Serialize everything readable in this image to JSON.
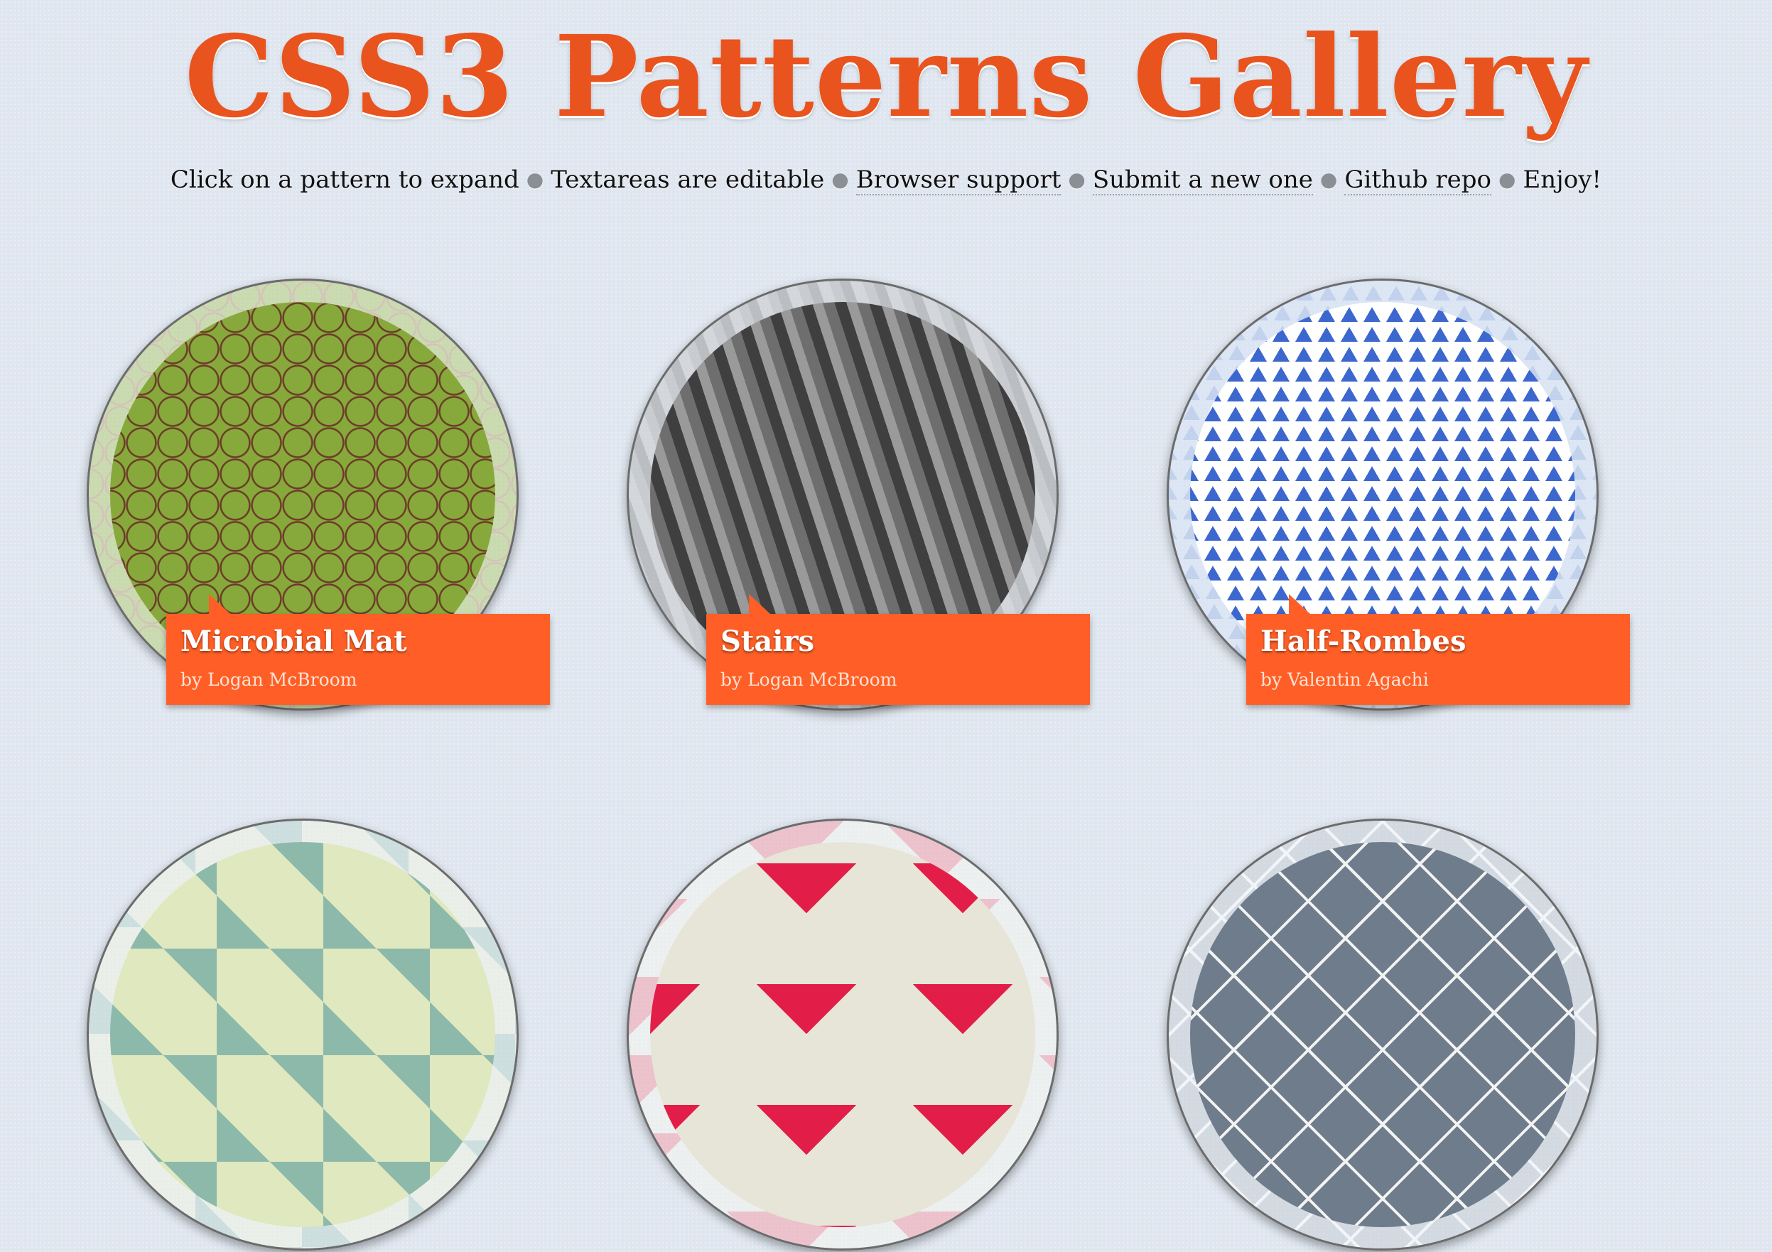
{
  "header": {
    "title": "CSS3 Patterns Gallery"
  },
  "intro": {
    "instructions": [
      {
        "text": "Click on a pattern to expand",
        "link": false
      },
      {
        "text": "Textareas are editable",
        "link": false
      },
      {
        "text": "Browser support",
        "link": true
      },
      {
        "text": "Submit a new one",
        "link": true
      },
      {
        "text": "Github repo",
        "link": true
      },
      {
        "text": "Enjoy!",
        "link": false
      }
    ]
  },
  "patterns": [
    {
      "name": "Microbial Mat",
      "author": "by Logan McBroom"
    },
    {
      "name": "Stairs",
      "author": "by Logan McBroom"
    },
    {
      "name": "Half-Rombes",
      "author": "by Valentin Agachi"
    }
  ],
  "colors": {
    "title": "#e9531e",
    "label_bg": "#ff5f26",
    "page_bg": "#dfe6ef"
  }
}
